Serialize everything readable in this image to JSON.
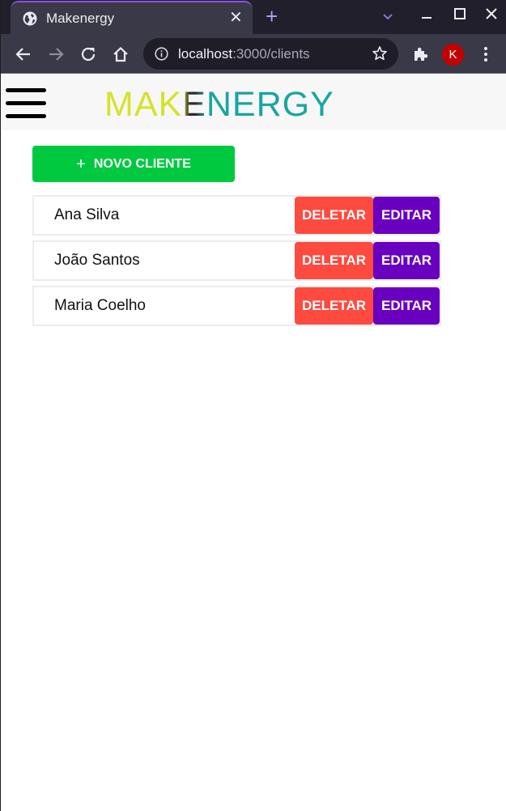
{
  "browser": {
    "tab_title": "Makenergy",
    "url_host": "localhost",
    "url_path": ":3000/clients",
    "profile_initial": "K",
    "accent": "#8a56e0"
  },
  "header": {
    "logo_part1": "MAK",
    "logo_part2": "E",
    "logo_part3": "NERGY"
  },
  "actions": {
    "new_client_label": "NOVO CLIENTE",
    "new_client_icon": "+"
  },
  "clients": [
    {
      "name": "Ana Silva",
      "delete_label": "DELETAR",
      "edit_label": "EDITAR"
    },
    {
      "name": "João Santos",
      "delete_label": "DELETAR",
      "edit_label": "EDITAR"
    },
    {
      "name": "Maria Coelho",
      "delete_label": "DELETAR",
      "edit_label": "EDITAR"
    }
  ],
  "colors": {
    "new_button": "#00c940",
    "delete_button": "#ff4a3f",
    "edit_button": "#6a00bf",
    "logo_yellow": "#d6e22a",
    "logo_teal": "#17a6a0"
  }
}
